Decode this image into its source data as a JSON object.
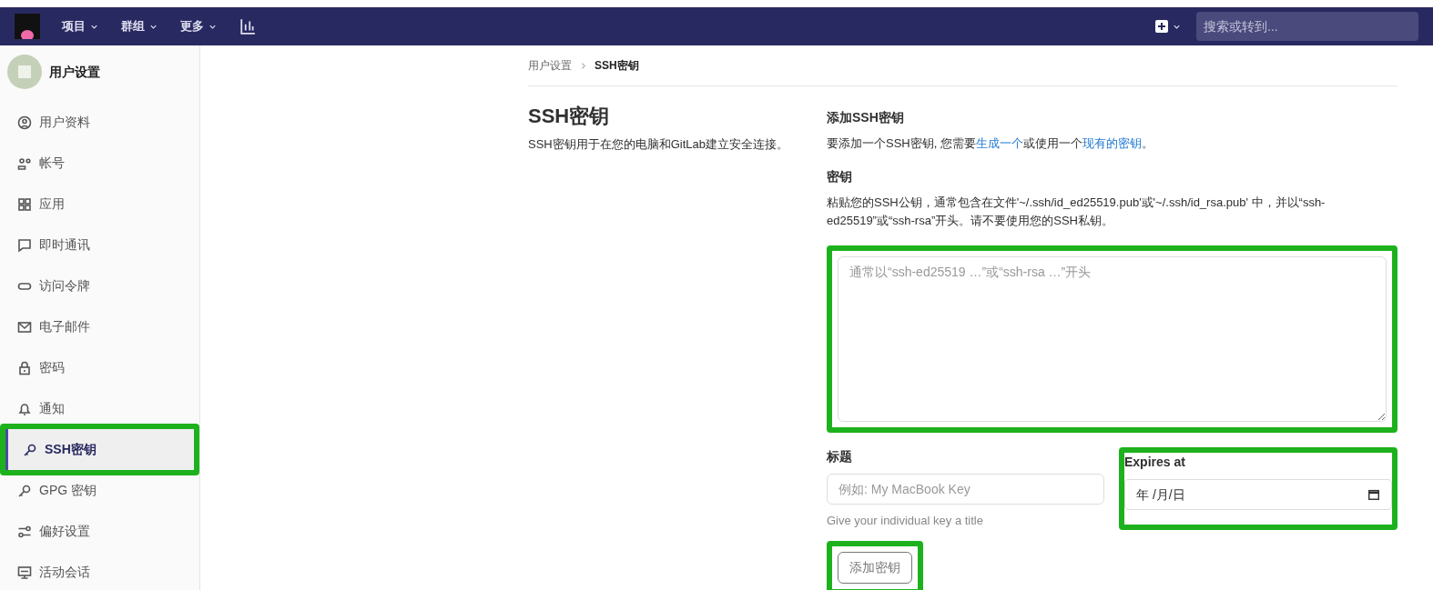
{
  "navbar": {
    "menus": [
      {
        "label": "项目"
      },
      {
        "label": "群组"
      },
      {
        "label": "更多"
      }
    ],
    "search": {
      "placeholder": "搜索或转到..."
    }
  },
  "sidebar": {
    "title": "用户设置",
    "items": [
      {
        "label": "用户资料",
        "kind": "profile",
        "selected": false,
        "highlighted": false
      },
      {
        "label": "帐号",
        "kind": "account",
        "selected": false,
        "highlighted": false
      },
      {
        "label": "应用",
        "kind": "apps",
        "selected": false,
        "highlighted": false
      },
      {
        "label": "即时通讯",
        "kind": "chat",
        "selected": false,
        "highlighted": false
      },
      {
        "label": "访问令牌",
        "kind": "token",
        "selected": false,
        "highlighted": false
      },
      {
        "label": "电子邮件",
        "kind": "mail",
        "selected": false,
        "highlighted": false
      },
      {
        "label": "密码",
        "kind": "lock",
        "selected": false,
        "highlighted": false
      },
      {
        "label": "通知",
        "kind": "bell",
        "selected": false,
        "highlighted": false
      },
      {
        "label": "SSH密钥",
        "kind": "key",
        "selected": true,
        "highlighted": true
      },
      {
        "label": "GPG 密钥",
        "kind": "key",
        "selected": false,
        "highlighted": false
      },
      {
        "label": "偏好设置",
        "kind": "prefs",
        "selected": false,
        "highlighted": false
      },
      {
        "label": "活动会话",
        "kind": "monitor",
        "selected": false,
        "highlighted": false
      }
    ]
  },
  "breadcrumb": [
    {
      "label": "用户设置"
    },
    {
      "label": "SSH密钥"
    }
  ],
  "intro": {
    "title": "SSH密钥",
    "description": "SSH密钥用于在您的电脑和GitLab建立安全连接。"
  },
  "form": {
    "heading": "添加SSH密钥",
    "help": [
      {
        "kind": "text",
        "text": "要添加一个SSH密钥, 您需要"
      },
      {
        "kind": "link",
        "text": "生成一个"
      },
      {
        "kind": "text",
        "text": "或使用一个"
      },
      {
        "kind": "link",
        "text": "现有的密钥"
      },
      {
        "kind": "text",
        "text": "。"
      }
    ],
    "key": {
      "label": "密钥",
      "description": "粘贴您的SSH公钥，通常包含在文件'~/.ssh/id_ed25519.pub'或'~/.ssh/id_rsa.pub' 中，并以“ssh-ed25519”或“ssh-rsa”开头。请不要使用您的SSH私钥。",
      "placeholder": "通常以“ssh-ed25519 …”或“ssh-rsa …”开头",
      "highlighted": true
    },
    "title": {
      "label": "标题",
      "placeholder": "例如: My MacBook Key",
      "hint": "Give your individual key a title"
    },
    "expires": {
      "label": "Expires at",
      "value": "年 /月/日",
      "highlighted": true
    },
    "submit": {
      "label": "添加密钥",
      "disabled": true,
      "highlighted": true
    }
  }
}
